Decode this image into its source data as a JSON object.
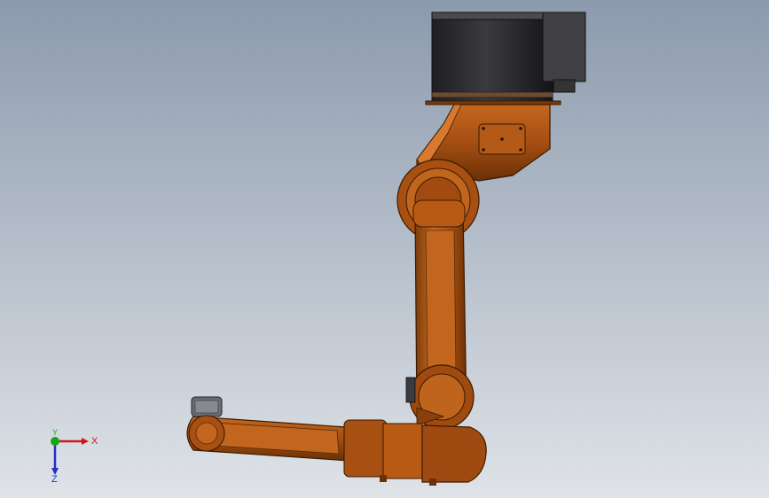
{
  "viewport": {
    "background_top": "#8c9aad",
    "background_bottom": "#dfe3e8"
  },
  "model": {
    "parts": [
      "base-motor",
      "rotary-base",
      "lower-arm",
      "elbow-joint",
      "forearm",
      "wrist-flange"
    ],
    "colors": {
      "arm_orange": "#b85a14",
      "arm_dark": "#5e2a05",
      "arm_light": "#d77a2e",
      "motor_dark": "#2b2b2e",
      "motor_mid": "#4a4a4f",
      "flange_gray": "#6a6e74"
    }
  },
  "triad": {
    "x_label": "X",
    "y_label": "Y",
    "z_label": "Z",
    "x_color": "#d01818",
    "y_color": "#19a319",
    "z_color": "#2030c8"
  }
}
